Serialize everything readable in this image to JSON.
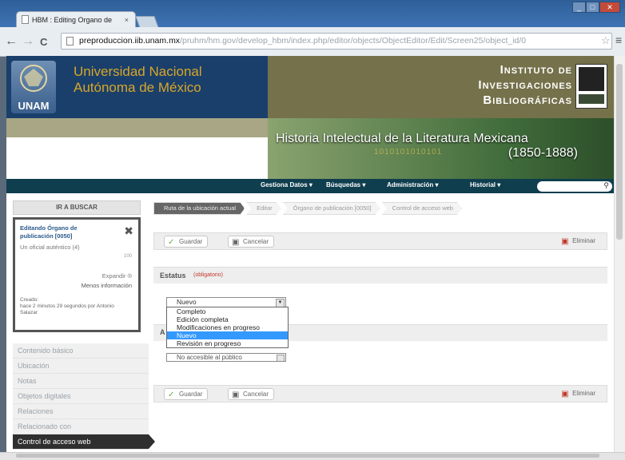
{
  "browser": {
    "tab_title": "HBM : Editing Organo de",
    "tab_close": "×",
    "url_host": "preproduccion.iib.unam.mx",
    "url_path": "/pruhm/hm.gov/develop_hbm/index.php/editor/objects/ObjectEditor/Edit/Screen25/object_id/0",
    "back": "←",
    "forward": "→",
    "reload": "C",
    "star": "☆",
    "menu": "≡"
  },
  "header": {
    "unam_label": "UNAM",
    "university_line1": "Universidad Nacional",
    "university_line2": "Autónoma de México",
    "institute_line1": "Instituto de",
    "institute_line2": "Investigaciones",
    "institute_line3": "Bibliográficas",
    "history_line1": "Historia Intelectual de la Literatura Mexicana",
    "history_line2": "(1850-1888)",
    "binary_text": "1010101010101"
  },
  "navbar": {
    "items": [
      "Gestiona Datos ▾",
      "Búsquedas ▾",
      "Administración ▾",
      "Historial ▾"
    ],
    "search_icon": "search-icon"
  },
  "sidebar": {
    "back_button": "IR A BUSCAR",
    "info": {
      "title": "Editando Órgano de publicación [0050]",
      "close": "✖",
      "subtitle": "Un oficial auténtico (4)",
      "count": "100",
      "expand": "Expandir ®",
      "less": "Menos información",
      "created_label": "Creado:",
      "created_text": "hace 2 minutos 29 segundos por Antonio Salazar"
    },
    "menu": [
      "Contenido básico",
      "Ubicación",
      "Notas",
      "Objetos digitales",
      "Relaciones",
      "Relacionado con",
      "Control de acceso web"
    ]
  },
  "breadcrumb": [
    "Ruta de la ubicación actual",
    "Editar",
    "Órgano de publicación [0050]",
    "Control de acceso web"
  ],
  "actions": {
    "save": "Guardar",
    "cancel": "Cancelar",
    "delete": "Eliminar"
  },
  "status": {
    "legend": "Estatus",
    "required": "(obligatorio)",
    "selected": "Nuevo",
    "options": [
      "Completo",
      "Edición completa",
      "Modificaciones en progreso",
      "Nuevo",
      "Revisión en progreso"
    ],
    "highlighted": "Nuevo"
  },
  "access": {
    "legend": "A",
    "selected": "No accesible al público"
  }
}
